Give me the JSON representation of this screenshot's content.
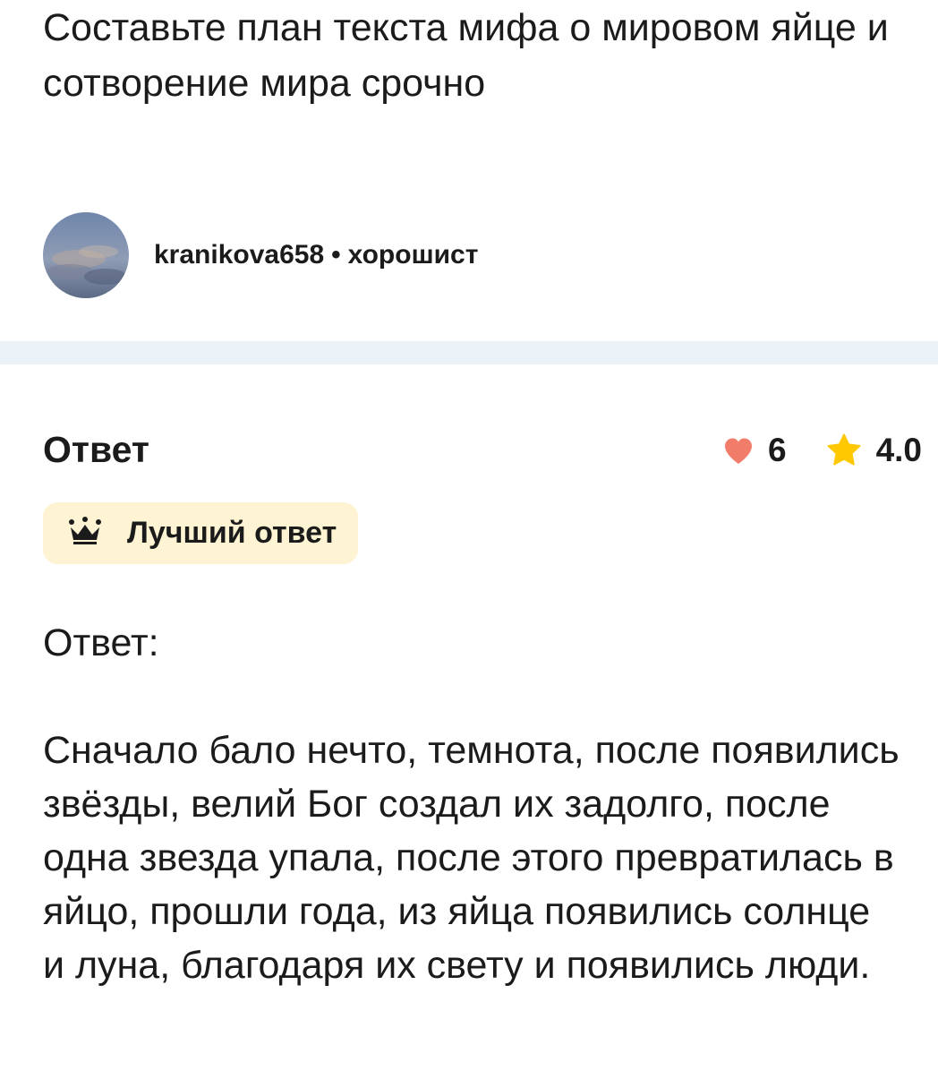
{
  "question": {
    "text": "Составьте план текста мифа о мировом яйце и сотворение мира срочно"
  },
  "author": {
    "username": "kranikova658",
    "separator": "•",
    "rank": "хорошист",
    "avatar_icon": "avatar-sky-photo"
  },
  "answer": {
    "heading": "Ответ",
    "likes_count": "6",
    "rating": "4.0",
    "like_icon": "heart-icon",
    "rating_icon": "star-icon",
    "heart_color": "#f27c6a",
    "star_color": "#ffc800",
    "badge": {
      "label": "Лучший ответ",
      "icon": "crown-icon",
      "background": "#fef4d3"
    },
    "body_lead": "Ответ:",
    "body_text": "Сначало бало нечто, темнота, после появились звёзды, велий Бог создал их задолго, после одна звезда упала, после этого превратилась в яйцо, прошли года, из яйца появились солнце и луна, благодаря их свету и появились люди."
  },
  "colors": {
    "divider": "#ebf2f7",
    "text": "#1b1b1b"
  }
}
